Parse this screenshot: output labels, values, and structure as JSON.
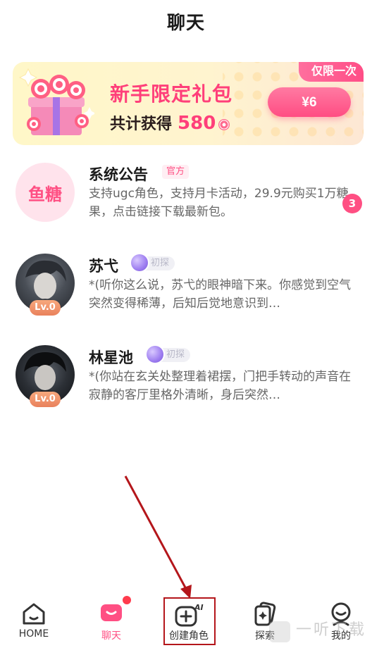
{
  "header": {
    "title": "聊天"
  },
  "banner": {
    "badge": "仅限一次",
    "title": "新手限定礼包",
    "subtitle_prefix": "共计获得",
    "subtitle_amount": "580",
    "price_label": "¥6",
    "accent_color": "#ff4f83"
  },
  "chats": [
    {
      "name": "系统公告",
      "tag": "官方",
      "avatar_text": "鱼糖",
      "preview": "支持ugc角色，支持月卡活动，29.9元购买1万糖果，点击链接下载最新包。",
      "unread": "3"
    },
    {
      "name": "苏弋",
      "tag": "初探",
      "level": "Lv.0",
      "preview": "*(听你这么说，苏弋的眼神暗下来。你感觉到空气突然变得稀薄，后知后觉地意识到…"
    },
    {
      "name": "林星池",
      "tag": "初探",
      "level": "Lv.0",
      "preview": "*(你站在玄关处整理着裙摆，门把手转动的声音在寂静的客厅里格外清晰，身后突然…"
    }
  ],
  "nav": [
    {
      "label": "HOME",
      "icon": "home-icon"
    },
    {
      "label": "聊天",
      "icon": "chat-icon",
      "active": true
    },
    {
      "label": "创建角色",
      "icon": "create-ai-icon"
    },
    {
      "label": "探索",
      "icon": "explore-cards-icon"
    },
    {
      "label": "我的",
      "icon": "profile-icon"
    }
  ],
  "watermark": "一听下载"
}
